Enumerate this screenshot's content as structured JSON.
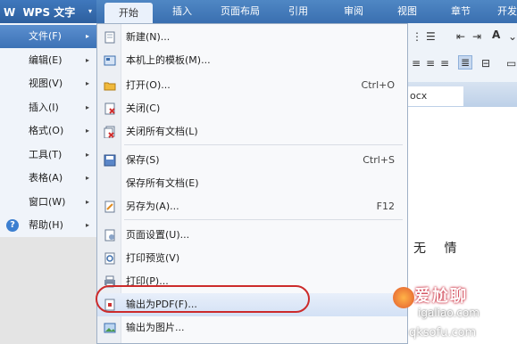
{
  "app": {
    "logo": "W",
    "name": "WPS 文字",
    "arrow": "▾"
  },
  "tabs": [
    "开始",
    "插入",
    "页面布局",
    "引用",
    "审阅",
    "视图",
    "章节",
    "开发"
  ],
  "main_menu": [
    {
      "label": "文件(F)",
      "arrow": "▸",
      "highlighted": true
    },
    {
      "label": "编辑(E)",
      "arrow": "▸"
    },
    {
      "label": "视图(V)",
      "arrow": "▸"
    },
    {
      "label": "插入(I)",
      "arrow": "▸"
    },
    {
      "label": "格式(O)",
      "arrow": "▸"
    },
    {
      "label": "工具(T)",
      "arrow": "▸"
    },
    {
      "label": "表格(A)",
      "arrow": "▸"
    },
    {
      "label": "窗口(W)",
      "arrow": "▸"
    },
    {
      "label": "帮助(H)",
      "arrow": "▸",
      "icon": "help-icon",
      "icon_char": "?"
    }
  ],
  "file_menu": [
    {
      "label": "新建(N)...",
      "shortcut": "",
      "icon": "new-document-icon"
    },
    {
      "label": "本机上的模板(M)...",
      "shortcut": "",
      "icon": "template-icon"
    },
    {
      "label": "打开(O)...",
      "shortcut": "Ctrl+O",
      "icon": "open-folder-icon"
    },
    {
      "label": "关闭(C)",
      "shortcut": "",
      "icon": "close-document-icon"
    },
    {
      "label": "关闭所有文档(L)",
      "shortcut": "",
      "icon": "close-all-icon"
    },
    {
      "label": "保存(S)",
      "shortcut": "Ctrl+S",
      "icon": "save-icon"
    },
    {
      "label": "保存所有文档(E)",
      "shortcut": "",
      "icon": ""
    },
    {
      "label": "另存为(A)...",
      "shortcut": "F12",
      "icon": "save-as-icon"
    },
    {
      "label": "页面设置(U)...",
      "shortcut": "",
      "icon": "page-setup-icon"
    },
    {
      "label": "打印预览(V)",
      "shortcut": "",
      "icon": "print-preview-icon"
    },
    {
      "label": "打印(P)...",
      "shortcut": "",
      "icon": "print-icon"
    },
    {
      "label": "输出为PDF(F)...",
      "shortcut": "",
      "icon": "pdf-export-icon",
      "highlighted": true
    },
    {
      "label": "输出为图片...",
      "shortcut": "",
      "icon": "image-export-icon"
    }
  ],
  "document": {
    "tab_label": "ocx",
    "text": "无 情"
  },
  "watermark": {
    "brand": "爱尬聊",
    "url": "igaliao.com",
    "url2": "qksofu.com"
  },
  "colors": {
    "ribbon": "#3a6fb0",
    "menu_highlight": "#3c72b6",
    "annotation_circle": "#cc2b2b"
  }
}
